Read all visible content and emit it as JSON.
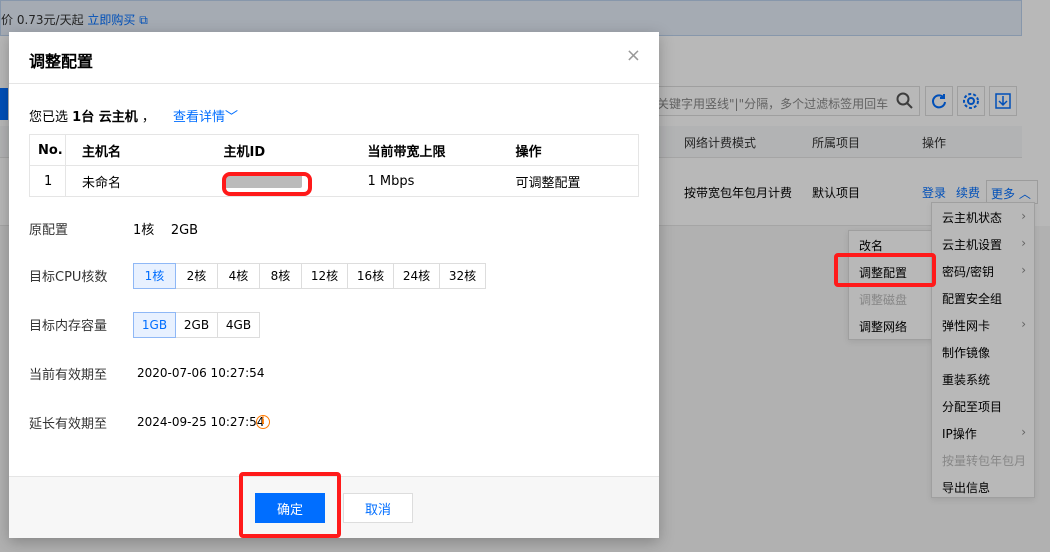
{
  "background": {
    "notice_price": "价 0.73元/天起",
    "notice_buy": "立即购买",
    "search_placeholder": "关键字用竖线\"|\"分隔，多个过滤标签用回车",
    "table_headers": {
      "network_billing": "网络计费模式",
      "project": "所属项目",
      "action": "操作"
    },
    "row": {
      "network_billing": "按带宽包年包月计费",
      "project": "默认项目",
      "login": "登录",
      "renew": "续费",
      "more": "更多"
    }
  },
  "submenu": {
    "items": [
      "改名",
      "调整配置",
      "调整磁盘",
      "调整网络"
    ],
    "disabled_index": 2
  },
  "more_menu": {
    "items": [
      "云主机状态",
      "云主机设置",
      "密码/密钥",
      "配置安全组",
      "弹性网卡",
      "制作镜像",
      "重装系统",
      "分配至项目",
      "IP操作",
      "按量转包年包月",
      "导出信息"
    ]
  },
  "modal": {
    "title": "调整配置",
    "close": "×",
    "selected_prefix": "您已选",
    "selected_count": "1台 云主机",
    "selected_suffix": "，",
    "view_details": "查看详情",
    "table": {
      "headers": [
        "No.",
        "主机名",
        "主机ID",
        "当前带宽上限",
        "操作"
      ],
      "rows": [
        [
          "1",
          "未命名",
          "",
          "1 Mbps",
          "可调整配置"
        ]
      ]
    },
    "original_config_label": "原配置",
    "original_cpu": "1核",
    "original_mem": "2GB",
    "target_cpu_label": "目标CPU核数",
    "cpu_options": [
      "1核",
      "2核",
      "4核",
      "8核",
      "12核",
      "16核",
      "24核",
      "32核"
    ],
    "cpu_selected": "1核",
    "target_mem_label": "目标内存容量",
    "mem_options": [
      "1GB",
      "2GB",
      "4GB"
    ],
    "mem_selected": "1GB",
    "current_expiry_label": "当前有效期至",
    "current_expiry": "2020-07-06 10:27:54",
    "extended_expiry_label": "延长有效期至",
    "extended_expiry": "2024-09-25 10:27:54",
    "ok_label": "确定",
    "cancel_label": "取消"
  },
  "colors": {
    "accent": "#006eff",
    "highlight_red": "#ff1a1a",
    "warning": "#ff7a00"
  }
}
